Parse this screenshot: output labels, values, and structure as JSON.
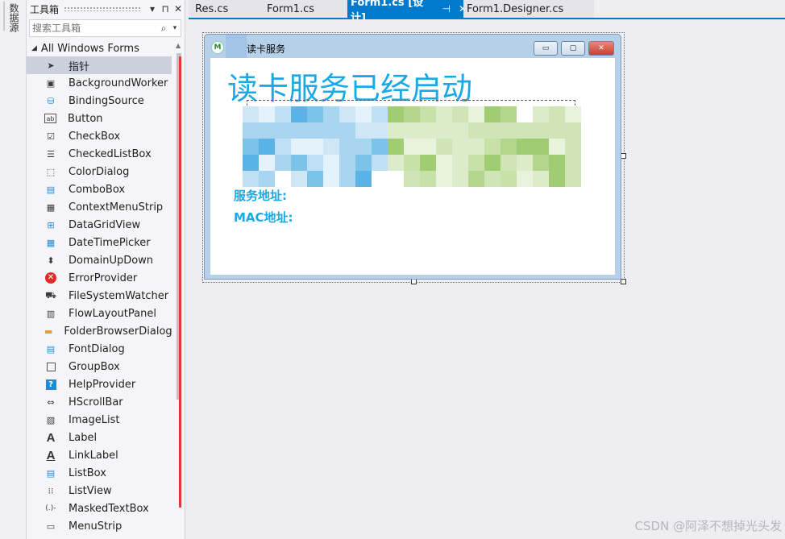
{
  "side_strip": {
    "label": "数据源"
  },
  "toolbox": {
    "title": "工具箱",
    "buttons": {
      "dropdown": "▾",
      "pin": "⊓",
      "close": "✕"
    },
    "search_placeholder": "搜索工具箱",
    "category": "All Windows Forms",
    "items": [
      {
        "label": "指针",
        "icon": "pointer-icon"
      },
      {
        "label": "BackgroundWorker",
        "icon": "background-worker-icon"
      },
      {
        "label": "BindingSource",
        "icon": "binding-source-icon"
      },
      {
        "label": "Button",
        "icon": "button-icon"
      },
      {
        "label": "CheckBox",
        "icon": "checkbox-icon"
      },
      {
        "label": "CheckedListBox",
        "icon": "checked-listbox-icon"
      },
      {
        "label": "ColorDialog",
        "icon": "color-dialog-icon"
      },
      {
        "label": "ComboBox",
        "icon": "combobox-icon"
      },
      {
        "label": "ContextMenuStrip",
        "icon": "context-menu-strip-icon"
      },
      {
        "label": "DataGridView",
        "icon": "datagridview-icon"
      },
      {
        "label": "DateTimePicker",
        "icon": "datetimepicker-icon"
      },
      {
        "label": "DomainUpDown",
        "icon": "domain-updown-icon"
      },
      {
        "label": "ErrorProvider",
        "icon": "error-provider-icon"
      },
      {
        "label": "FileSystemWatcher",
        "icon": "filesystem-watcher-icon"
      },
      {
        "label": "FlowLayoutPanel",
        "icon": "flow-layout-panel-icon"
      },
      {
        "label": "FolderBrowserDialog",
        "icon": "folder-browser-dialog-icon"
      },
      {
        "label": "FontDialog",
        "icon": "font-dialog-icon"
      },
      {
        "label": "GroupBox",
        "icon": "groupbox-icon"
      },
      {
        "label": "HelpProvider",
        "icon": "help-provider-icon"
      },
      {
        "label": "HScrollBar",
        "icon": "hscrollbar-icon"
      },
      {
        "label": "ImageList",
        "icon": "imagelist-icon"
      },
      {
        "label": "Label",
        "icon": "label-icon"
      },
      {
        "label": "LinkLabel",
        "icon": "linklabel-icon"
      },
      {
        "label": "ListBox",
        "icon": "listbox-icon"
      },
      {
        "label": "ListView",
        "icon": "listview-icon"
      },
      {
        "label": "MaskedTextBox",
        "icon": "masked-textbox-icon"
      },
      {
        "label": "MenuStrip",
        "icon": "menustrip-icon"
      }
    ]
  },
  "tabs": [
    {
      "label": "Res.cs",
      "active": false
    },
    {
      "label": "Form1.cs",
      "active": false
    },
    {
      "label": "Form1.cs [设计]",
      "active": true
    },
    {
      "label": "Form1.Designer.cs",
      "active": false
    }
  ],
  "tab_icons": {
    "pin": "⊣",
    "close": "✕"
  },
  "form": {
    "title": "读卡服务",
    "window_buttons": {
      "minimize": "▭",
      "maximize": "▢",
      "close": "✕"
    },
    "heading": "读卡服务已经启动",
    "service_label": "服务地址:",
    "mac_label": "MAC地址:"
  },
  "colors": {
    "accent": "#007acc",
    "heading": "#1aa9e6",
    "selection": "#ccd0dd",
    "scroll_marker": "#e4382d"
  },
  "watermark": "CSDN @阿泽不想掉光头发"
}
